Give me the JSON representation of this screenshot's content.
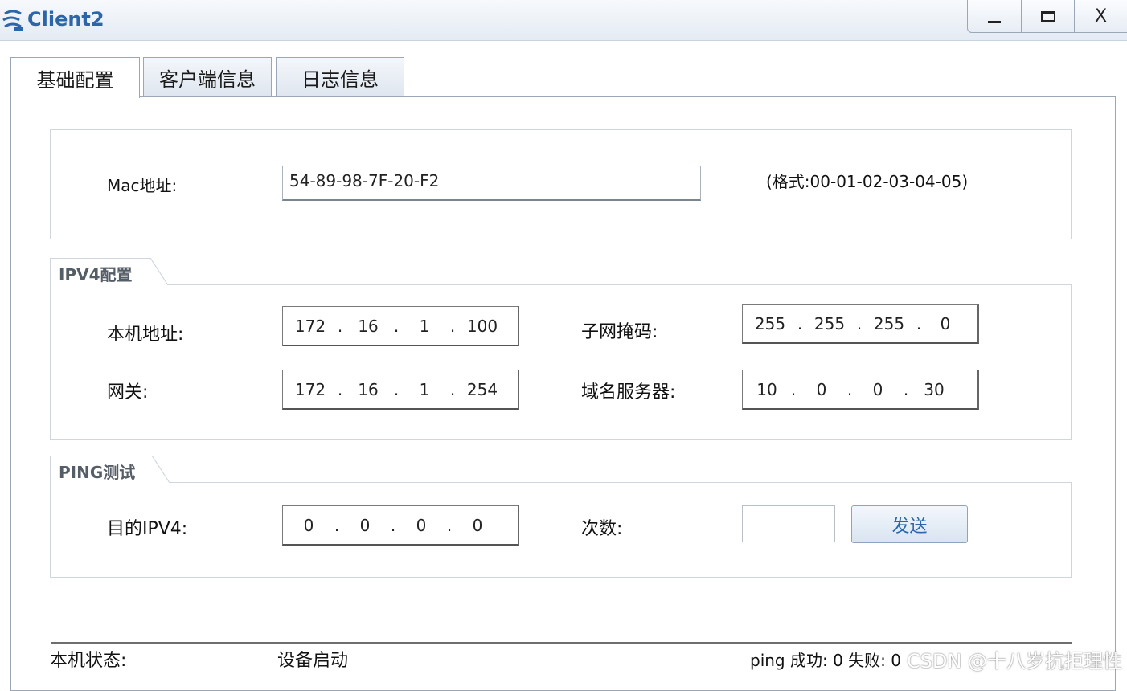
{
  "window": {
    "title": "Client2",
    "minimize": "_",
    "close": "X"
  },
  "tabs": [
    "基础配置",
    "客户端信息",
    "日志信息"
  ],
  "mac": {
    "label": "Mac地址:",
    "value": "54-89-98-7F-20-F2",
    "format_hint": "(格式:00-01-02-03-04-05)"
  },
  "ipv4": {
    "section_title": "IPV4配置",
    "local_ip_label": "本机地址:",
    "local_ip": [
      "172",
      "16",
      "1",
      "100"
    ],
    "subnet_label": "子网掩码:",
    "subnet": [
      "255",
      "255",
      "255",
      "0"
    ],
    "gateway_label": "网关:",
    "gateway": [
      "172",
      "16",
      "1",
      "254"
    ],
    "dns_label": "域名服务器:",
    "dns": [
      "10",
      "0",
      "0",
      "30"
    ]
  },
  "ping": {
    "section_title": "PING测试",
    "target_label": "目的IPV4:",
    "target": [
      "0",
      "0",
      "0",
      "0"
    ],
    "count_label": "次数:",
    "count_value": "",
    "send_label": "发送"
  },
  "status": {
    "label": "本机状态:",
    "value": "设备启动",
    "ping_result": "ping 成功: 0 失败: 0"
  },
  "watermark": "CSDN @十八岁抗拒理性"
}
